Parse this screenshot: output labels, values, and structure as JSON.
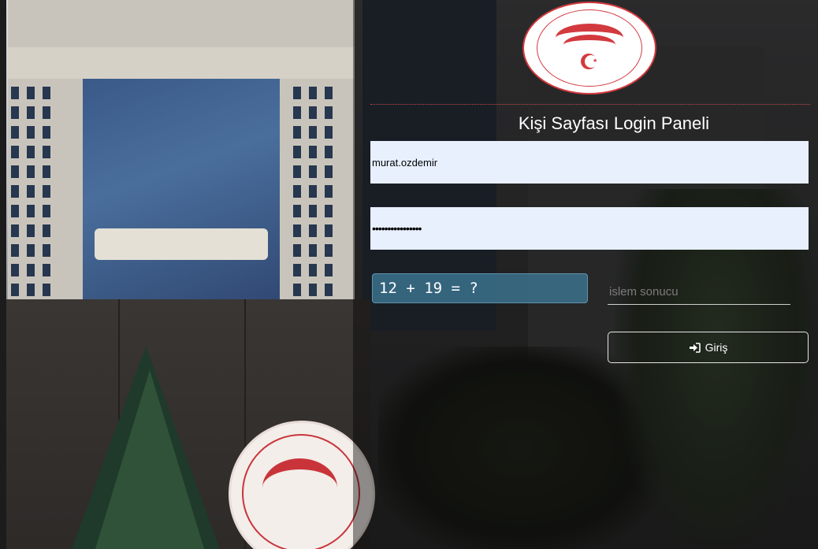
{
  "header": {
    "title": "Kişi Sayfası Login Paneli"
  },
  "form": {
    "username_value": "murat.ozdemir",
    "password_value": "••••••••••••••••",
    "captcha_text": "12 + 19 = ?",
    "result_placeholder": "islem sonucu",
    "login_label": "Giriş"
  },
  "icons": {
    "logo": "ministry-seal-icon",
    "login": "sign-in-icon"
  },
  "colors": {
    "accent_red": "#d23a3f",
    "captcha_bg": "#3e7896",
    "field_bg": "#e8f0fe"
  }
}
